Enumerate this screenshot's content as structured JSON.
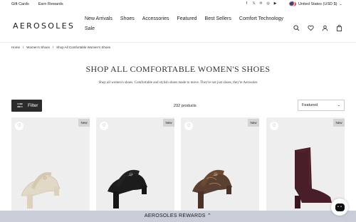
{
  "topbar": {
    "gift_cards": "Gift Cards",
    "earn_rewards": "Earn Rewards",
    "socials": [
      "facebook-icon",
      "x-icon",
      "pinterest-icon",
      "instagram-icon",
      "youtube-icon"
    ],
    "region": "United States (USD $)"
  },
  "header": {
    "logo": "AEROSOLES",
    "nav": [
      "New Arrivals",
      "Shoes",
      "Accessories",
      "Featured",
      "Best Sellers",
      "Comfort Technology",
      "Sale"
    ],
    "icons": [
      "search-icon",
      "heart-icon",
      "account-icon",
      "bag-icon"
    ]
  },
  "breadcrumb": [
    "Home",
    "/",
    "Women's Shoes",
    "/",
    "Shop All Comfortable Women's Shoes"
  ],
  "page": {
    "title": "SHOP ALL COMFORTABLE WOMEN'S SHOES",
    "subtitle": "Shop all women's shoes. Comfortable and stylish shoes made to move. They're not just shoes, they're Aerosoles"
  },
  "toolbar": {
    "filter_label": "Filter",
    "count": "232 products",
    "sort_value": "Featured"
  },
  "products": [
    {
      "badge": "New",
      "color": "#e2d8c6"
    },
    {
      "badge": "New",
      "color": "#1c1c1c"
    },
    {
      "badge": "New",
      "color": "#5a4030"
    },
    {
      "badge": "New",
      "color": "#4a1e28"
    }
  ],
  "rewards": {
    "label": "AEROSOLES REWARDS ⌃"
  },
  "colors": {
    "filter_bg": "#2b2b2b",
    "rewards_bg": "#c8cdd7",
    "card_bg": "#eeeeee"
  }
}
